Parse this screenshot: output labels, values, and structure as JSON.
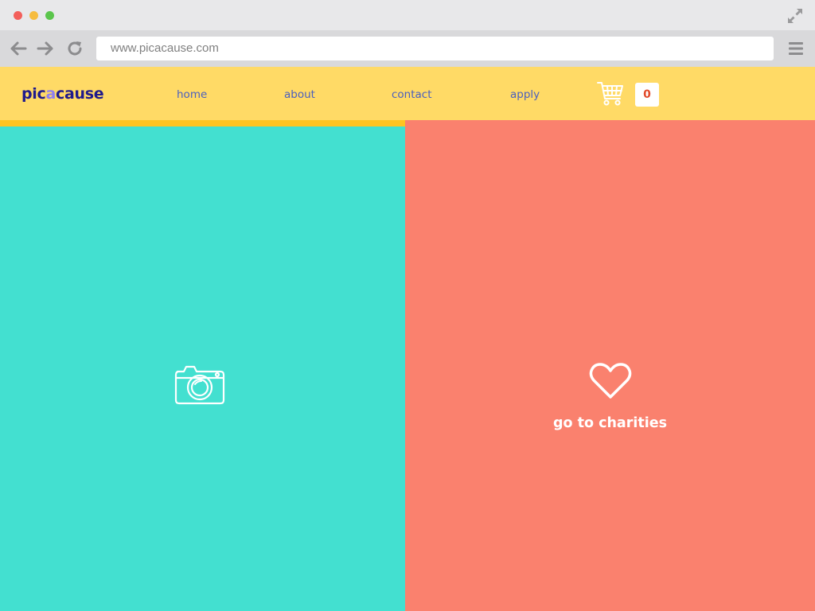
{
  "browser": {
    "url": "www.picacause.com"
  },
  "header": {
    "logo": {
      "part1": "pic",
      "part2": "a",
      "part3": "cause"
    },
    "nav": [
      {
        "label": "home"
      },
      {
        "label": "about"
      },
      {
        "label": "contact"
      },
      {
        "label": "apply"
      }
    ],
    "cart_count": "0"
  },
  "right_panel": {
    "label": "go to charities"
  },
  "colors": {
    "header_bg": "#ffda66",
    "accent_bar": "#ffc421",
    "left_panel": "#43e0d0",
    "right_panel": "#fa816e",
    "logo": "#1f1a8c",
    "nav_link": "#4a5fbf",
    "cart_count": "#e24a2b"
  },
  "icons": {
    "left_panel": "camera-icon",
    "right_panel": "heart-icon",
    "cart": "shopping-cart-icon"
  }
}
